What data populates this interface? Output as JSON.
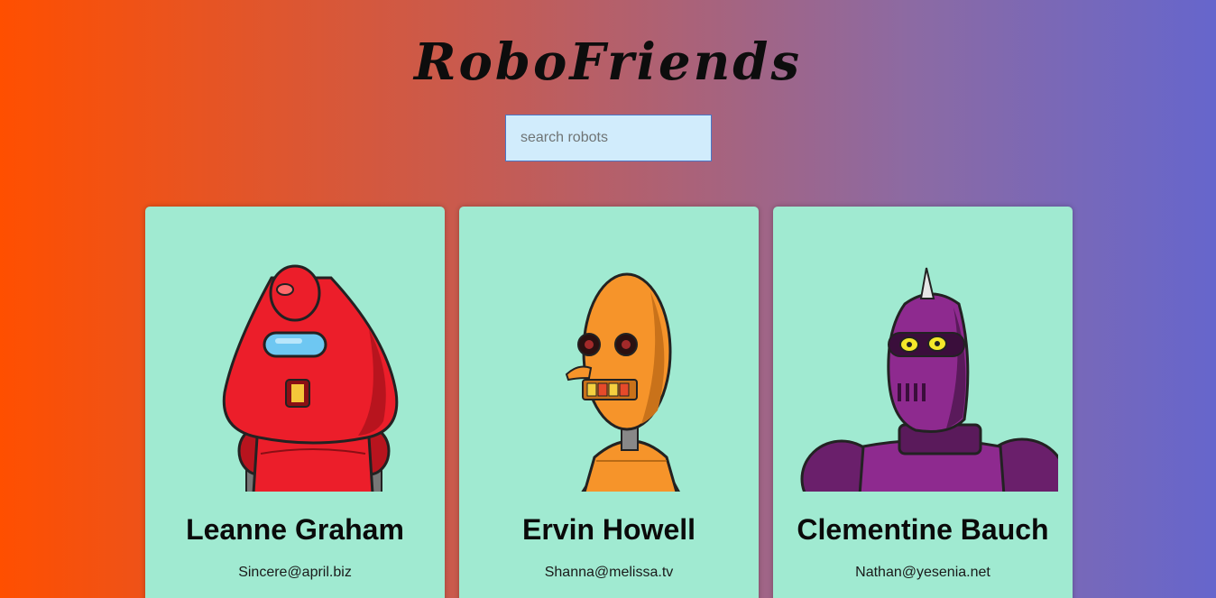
{
  "header": {
    "title": "RoboFriends"
  },
  "search": {
    "placeholder": "search robots",
    "value": ""
  },
  "robots": [
    {
      "name": "Leanne Graham",
      "email": "Sincere@april.biz",
      "avatar": "red-robot-avatar",
      "color": "#e8212c"
    },
    {
      "name": "Ervin Howell",
      "email": "Shanna@melissa.tv",
      "avatar": "orange-robot-avatar",
      "color": "#f39a2a"
    },
    {
      "name": "Clementine Bauch",
      "email": "Nathan@yesenia.net",
      "avatar": "purple-robot-avatar",
      "color": "#8e2a8f"
    }
  ],
  "colors": {
    "background_start": "#ff4f00",
    "background_end": "#6666cc",
    "card": "#a0ead1",
    "search_bg": "#d1ecfc"
  }
}
